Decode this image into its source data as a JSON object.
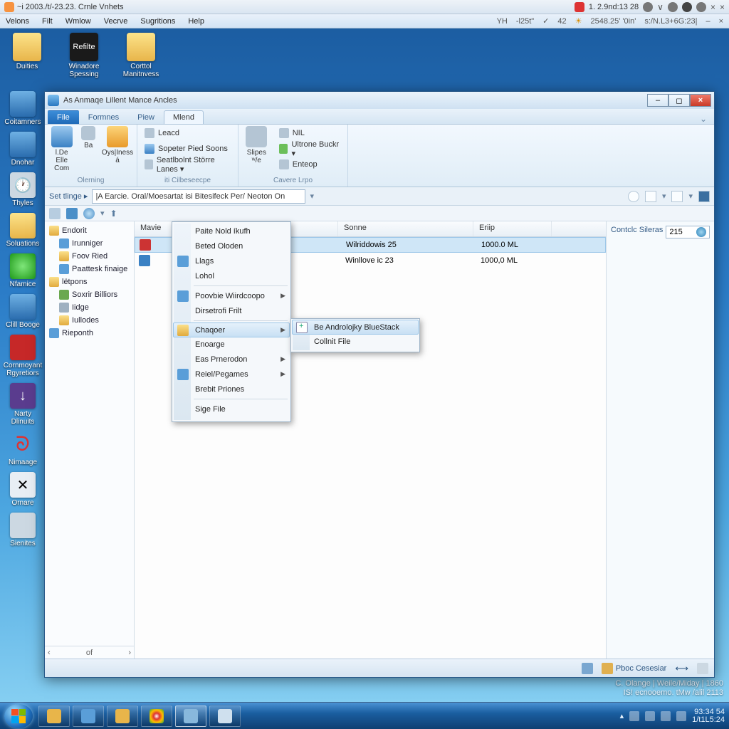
{
  "titlebar": {
    "left": "~i 2003./t/-23.23. Crnle Vnhets",
    "right_text": "1. 2.9nd:13 28",
    "x1": "×",
    "x2": "×"
  },
  "menubar": {
    "items": [
      "Velons",
      "Filt",
      "Wmlow",
      "Vecrve",
      "Sugritions",
      "Help"
    ],
    "right": [
      "YH",
      "-l25t\"",
      "✓",
      "42",
      "2548.25'  '0in'",
      "s:/N.L3+6G:23|"
    ]
  },
  "desktop_row": [
    {
      "label": "Duities",
      "cls": "g-folder"
    },
    {
      "label": "Winadore Spessing",
      "cls": "g-dark",
      "txt": "Refilte"
    },
    {
      "label": "Corttol Manitnvess",
      "cls": "g-folder"
    }
  ],
  "desktop_col": [
    {
      "label": "Coitamners",
      "cls": "g-blue"
    },
    {
      "label": "Dnohar",
      "cls": "g-blue"
    },
    {
      "label": "Thyles",
      "cls": "g-gray"
    },
    {
      "label": "Soluations",
      "cls": "g-folder"
    },
    {
      "label": "Nfamice",
      "cls": "g-green"
    },
    {
      "label": "Clill Booge",
      "cls": "g-blue"
    },
    {
      "label": "Cornmoyant Rgyretiors",
      "cls": "g-red"
    },
    {
      "label": "Narty Dlinuits",
      "cls": "g-purple"
    },
    {
      "label": "Nimaage",
      "cls": "g-red"
    },
    {
      "label": "Ornare",
      "cls": "g-xy"
    },
    {
      "label": "Sienites",
      "cls": "g-gray"
    }
  ],
  "window": {
    "title": "As Anmaqe Lillent Mance Ancles",
    "tabs": {
      "file": "File",
      "t1": "Formnes",
      "t2": "Piew",
      "t3": "Mlend"
    },
    "ribbon": {
      "g1": {
        "big": [
          {
            "label": "l.De Elle Com"
          },
          {
            "label": "Ba"
          },
          {
            "label": "Oys|Iness á"
          }
        ],
        "caption": "Olerning"
      },
      "g2": {
        "items": [
          "Leacd",
          "Sopeter Pied Soons",
          "Seatlbolnt Större Lanes ▾"
        ],
        "caption": "iti Cilbeseecpe"
      },
      "g3": {
        "big": [
          {
            "label": "Slipes ʷ/e"
          }
        ],
        "items": [
          "NIL",
          "Ultrone Buckr ▾",
          "Enteop"
        ],
        "caption": "Cavere Lrpo"
      }
    },
    "locbar": {
      "label": "Set tlinge ▸",
      "path": "|A Earcie. Oral/Moesartat isi Bitesifeck  Per/ Neoton On"
    },
    "tree": [
      {
        "label": "Endorit",
        "cls": "tfolder",
        "child": false
      },
      {
        "label": "Irunniger",
        "cls": "tblue",
        "child": true
      },
      {
        "label": "Foov Ried",
        "cls": "tfolder",
        "child": true
      },
      {
        "label": "Paattesk finaige",
        "cls": "tblue",
        "child": true
      },
      {
        "label": "lëtpons",
        "cls": "tfolder",
        "child": false
      },
      {
        "label": "Soxrir Billiors",
        "cls": "tgrn",
        "child": true
      },
      {
        "label": "Iidge",
        "cls": "tgry",
        "child": true
      },
      {
        "label": "Iullodes",
        "cls": "tfolder",
        "child": true
      },
      {
        "label": "Rieponth",
        "cls": "tblue",
        "child": false
      }
    ],
    "side_bottom": {
      "l": "‹",
      "c": "of",
      "r": "›"
    },
    "columns": [
      "Mavie",
      "Sonne",
      "Eriip"
    ],
    "rows": [
      {
        "c1": "",
        "c2": "Wilriddowis 25",
        "c3": "1000.0 ML",
        "sel": true,
        "icn": "red"
      },
      {
        "c1": "",
        "c2": "Winllove ic 23",
        "c3": "1000,0 ML",
        "sel": false,
        "icn": "blu"
      }
    ],
    "search": {
      "label": "Contclc Sileras",
      "value": "215"
    },
    "status": {
      "label": "Pboc Cesesiar",
      "arrows": "⟷"
    }
  },
  "context": {
    "items": [
      {
        "label": "Paite Nold íkufh"
      },
      {
        "label": "Beted Oloden"
      },
      {
        "label": "Llags",
        "icon": "tblue"
      },
      {
        "label": "Lohol"
      },
      {
        "sep": true
      },
      {
        "label": "Poovbie Wiirdcoopo",
        "icon": "tblue",
        "arrow": true
      },
      {
        "label": "Dirsetrofi Frilt"
      },
      {
        "sep": true
      },
      {
        "label": "Chaqoer",
        "icon": "tfolder",
        "arrow": true,
        "hl": true
      },
      {
        "label": "Enoarge"
      },
      {
        "label": "Eas Prnerodon",
        "arrow": true
      },
      {
        "label": "Reiel/Pegames",
        "icon": "tblue",
        "arrow": true
      },
      {
        "label": "Brebit Priones"
      },
      {
        "sep": true
      },
      {
        "label": "Sige File"
      }
    ],
    "sub": [
      {
        "label": "Be Androlojky BlueStack",
        "icon": "plus",
        "hl": true
      },
      {
        "label": "Collnit File"
      }
    ]
  },
  "desktop_text": {
    "l1": "C. Olange | Weile/Miday | 1860",
    "l2": "IS! ecnooemo. tMw /alil 2113"
  },
  "taskbar": {
    "tray_clock": {
      "l1": "93:34 54",
      "l2": "1/t1L5:24"
    }
  }
}
